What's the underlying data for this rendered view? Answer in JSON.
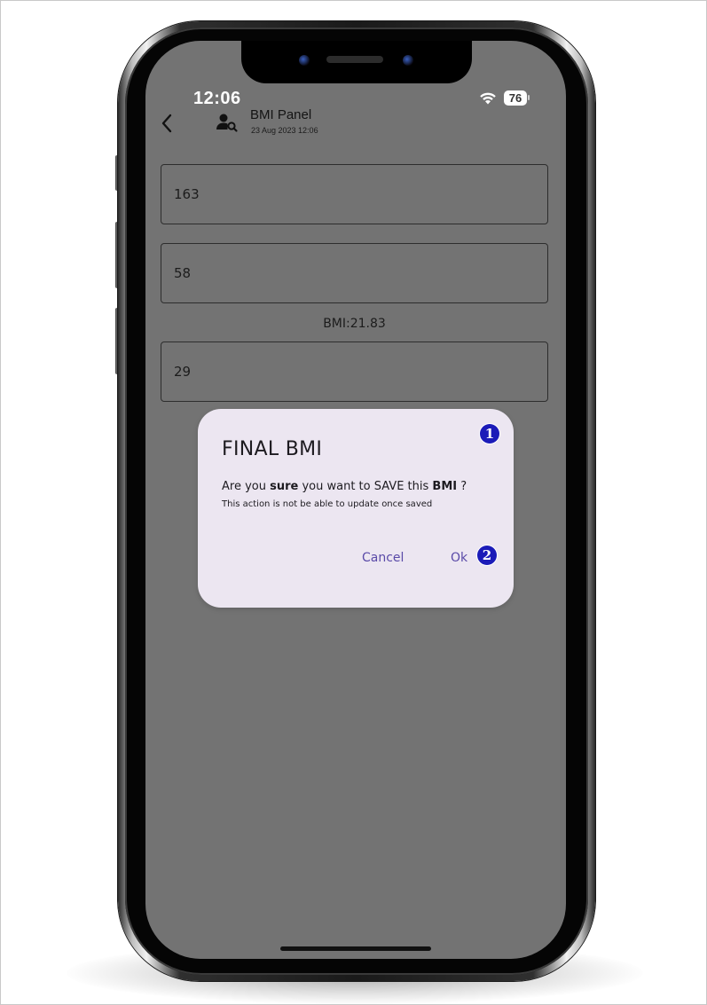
{
  "status_bar": {
    "time": "12:06",
    "battery": "76"
  },
  "header": {
    "title": "BMI Panel",
    "subtitle": "23 Aug 2023 12:06"
  },
  "form": {
    "height_value": "163",
    "weight_value": "58",
    "bmi_label": "BMI:21.83",
    "age_value": "29"
  },
  "dialog": {
    "title": "FINAL BMI",
    "body_part1": "Are you ",
    "body_bold1": "sure",
    "body_part2": " you want to SAVE this ",
    "body_bold2": "BMI",
    "body_part3": " ?",
    "note": "This action is not be able to update once saved",
    "cancel_label": "Cancel",
    "ok_label": "Ok"
  },
  "markers": {
    "marker1": "1",
    "marker2": "2"
  },
  "colors": {
    "screen_overlay": "#737373",
    "dialog_bg": "#ece6f1",
    "button_text": "#5a4aa8",
    "marker_bg": "#1b1bb8"
  }
}
